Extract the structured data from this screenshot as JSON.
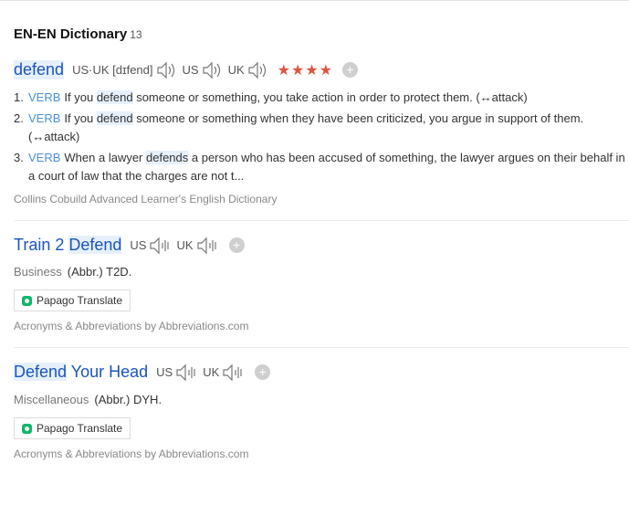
{
  "section": {
    "title": "EN-EN Dictionary",
    "count": "13"
  },
  "entry1": {
    "word": "defend",
    "pron_label": "US·UK [dɪfend]",
    "us_label": "US",
    "uk_label": "UK",
    "stars": "★★★★",
    "rating": 4,
    "defs": [
      {
        "num": "1.",
        "pos": "VERB",
        "pre": "If you ",
        "hl": "defend",
        "post": " someone or something, you take action in order to protect them. (↔attack)"
      },
      {
        "num": "2.",
        "pos": "VERB",
        "pre": "If you ",
        "hl": "defend",
        "post": " someone or something when they have been criticized, you argue in support of them. (↔attack)"
      },
      {
        "num": "3.",
        "pos": "VERB",
        "pre": "When a lawyer ",
        "hl": "defends",
        "post": " a person who has been accused of something, the lawyer argues on their behalf in a court of law that the charges are not t..."
      }
    ],
    "source": "Collins Cobuild Advanced Learner's English Dictionary"
  },
  "entry2": {
    "word_pre": "Train 2 ",
    "word_hl": "Defend",
    "us_label": "US",
    "uk_label": "UK",
    "category": "Business",
    "abbr": "(Abbr.) T2D.",
    "translate_label": "Papago Translate",
    "source": "Acronyms & Abbreviations by Abbreviations.com"
  },
  "entry3": {
    "word_hl": "Defend",
    "word_post": " Your Head",
    "us_label": "US",
    "uk_label": "UK",
    "category": "Miscellaneous",
    "abbr": "(Abbr.) DYH.",
    "translate_label": "Papago Translate",
    "source": "Acronyms & Abbreviations by Abbreviations.com"
  },
  "colors": {
    "word": "#1a55c2",
    "pos": "#4a90d9",
    "stars": "#e0533e",
    "highlight": "#e6f0fb"
  },
  "icons": {
    "speaker": "speaker-icon",
    "plus": "plus-icon",
    "papago": "papago-logo-icon"
  }
}
